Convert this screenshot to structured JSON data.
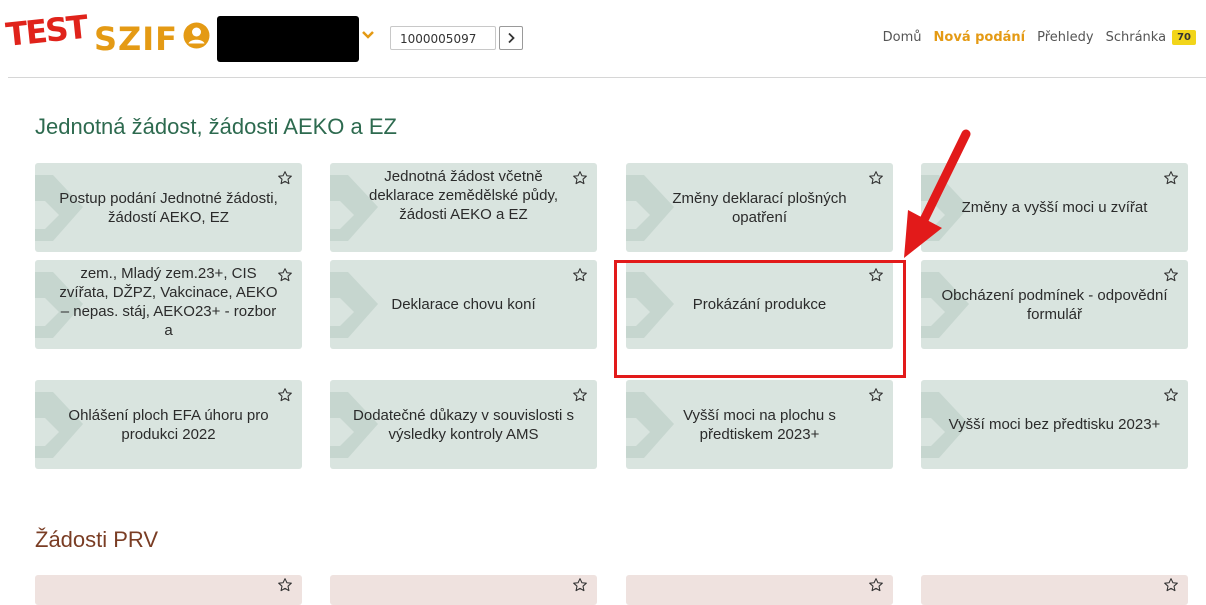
{
  "header": {
    "logo_test": "TEST",
    "logo_szif": "SZIF",
    "ident_value": "1000005097",
    "nav": [
      {
        "label": "Domů",
        "active": false
      },
      {
        "label": "Nová podání",
        "active": true
      },
      {
        "label": "Přehledy",
        "active": false
      },
      {
        "label": "Schránka",
        "active": false
      }
    ],
    "badge": "70"
  },
  "section1": {
    "title": "Jednotná žádost, žádosti AEKO a EZ",
    "tiles": [
      {
        "label": "Postup podání Jednotné žádosti, žádostí AEKO, EZ"
      },
      {
        "label": "Jednotná žádost včetně deklarace zemědělské půdy, žádosti AEKO a EZ"
      },
      {
        "label": "Změny deklarací plošných opatření"
      },
      {
        "label": "Změny a vyšší moci u zvířat"
      },
      {
        "label": "zem., Mladý zem.23+, CIS zvířata, DŽPZ, Vakcinace, AEKO – nepas. stáj, AEKO23+ - rozbor a"
      },
      {
        "label": "Deklarace chovu koní"
      },
      {
        "label": "Prokázání produkce"
      },
      {
        "label": "Obcházení podmínek - odpovědní formulář"
      },
      {
        "label": "Ohlášení ploch EFA úhoru pro produkci 2022"
      },
      {
        "label": "Dodatečné důkazy v souvislosti s výsledky kontroly AMS"
      },
      {
        "label": "Vyšší moci na plochu s předtiskem 2023+"
      },
      {
        "label": "Vyšší moci bez předtisku 2023+"
      }
    ]
  },
  "section2": {
    "title": "Žádosti PRV"
  },
  "colors": {
    "accent_orange": "#e49a14",
    "test_red": "#e0231b",
    "section1_title": "#2d6a4f",
    "section2_title": "#7a3d24",
    "tile_green": "#d9e4df",
    "tile_prv": "#efe2df",
    "highlight_red": "#e21a1a"
  },
  "icons": {
    "user": "user-circle-icon",
    "chevron": "chevron-down-icon",
    "go": "chevron-right-icon",
    "star": "star-outline-icon",
    "arrow": "red-arrow-annotation"
  }
}
